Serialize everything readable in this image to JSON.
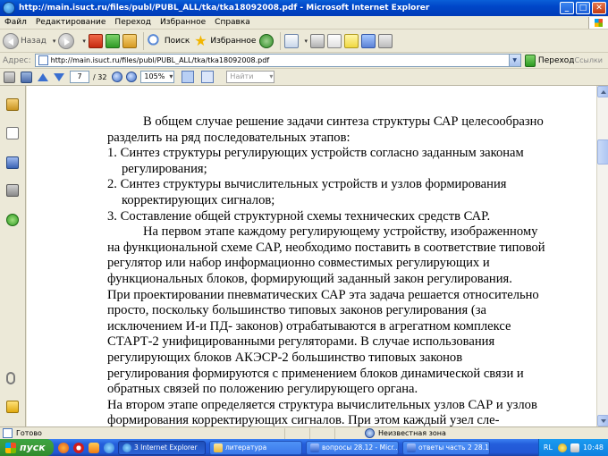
{
  "window": {
    "title": "http://main.isuct.ru/files/publ/PUBL_ALL/tka/tka18092008.pdf - Microsoft Internet Explorer",
    "min_glyph": "_",
    "max_glyph": "□",
    "close_glyph": "✕"
  },
  "menu": [
    "Файл",
    "Редактирование",
    "Переход",
    "Избранное",
    "Справка"
  ],
  "toolbar": {
    "back_label": "Назад",
    "search_label": "Поиск",
    "favorites_label": "Избранное"
  },
  "address": {
    "label": "Адрес:",
    "url": "http://main.isuct.ru/files/publ/PUBL_ALL/tka/tka18092008.pdf",
    "go_label": "Переход",
    "links_label": "Ссылки"
  },
  "pdf_toolbar": {
    "current_page": "7",
    "total_pages": "/ 32",
    "zoom": "105%",
    "find_placeholder": "Найти"
  },
  "document": {
    "paragraphs": [
      {
        "style": "indent",
        "text": "В общем случае решение задачи синтеза структуры САР целесообразно разделить на ряд последовательных этапов:"
      },
      {
        "style": "li",
        "text": "1. Синтез структуры регулирующих устройств согласно заданным законам регулирования;"
      },
      {
        "style": "li",
        "text": "2. Синтез структуры вычислительных устройств и узлов формирования корректирующих сигналов;"
      },
      {
        "style": "li",
        "text": "3. Составление общей структурной схемы технических средств САР."
      },
      {
        "style": "indent",
        "text": "На первом этапе каждому регулирующему устройству, изображенному на функциональной схеме САР, необходимо поставить в соответствие типовой регулятор или набор информационно совместимых регулирующих и функциональных блоков, формирующий заданный закон регулирования."
      },
      {
        "style": "plain",
        "text": "При проектировании пневматических САР эта задача решается относительно просто, поскольку большинство типовых законов регулирования (за исключением И-и ПД- законов) отрабатываются в агрегатном комплексе СТАРТ-2 унифицированными регуляторами. В случае использования регулирующих блоков АКЭСР-2 большинство типовых законов регулирования формируются с применением блоков динамической связи и обратных связей по положению регулирующего органа."
      },
      {
        "style": "plain",
        "text": "На втором этапе определяется структура вычислительных узлов САР и узлов формирования корректирующих сигналов. При этом каждый узел сле-"
      }
    ]
  },
  "status": {
    "text": "Готово",
    "zone": "Неизвестная зона"
  },
  "taskbar": {
    "start_label": "пуск",
    "tasks": [
      {
        "label": "3 Internet Explorer",
        "icon": "ie-icon",
        "active": true
      },
      {
        "label": "литература",
        "icon": "folder-icon",
        "active": false
      },
      {
        "label": "вопросы 28.12 - Micr...",
        "icon": "word-icon",
        "active": false
      },
      {
        "label": "ответы часть 2 28.1...",
        "icon": "word-icon",
        "active": false
      }
    ],
    "lang": "RL",
    "clock": "10:48"
  }
}
